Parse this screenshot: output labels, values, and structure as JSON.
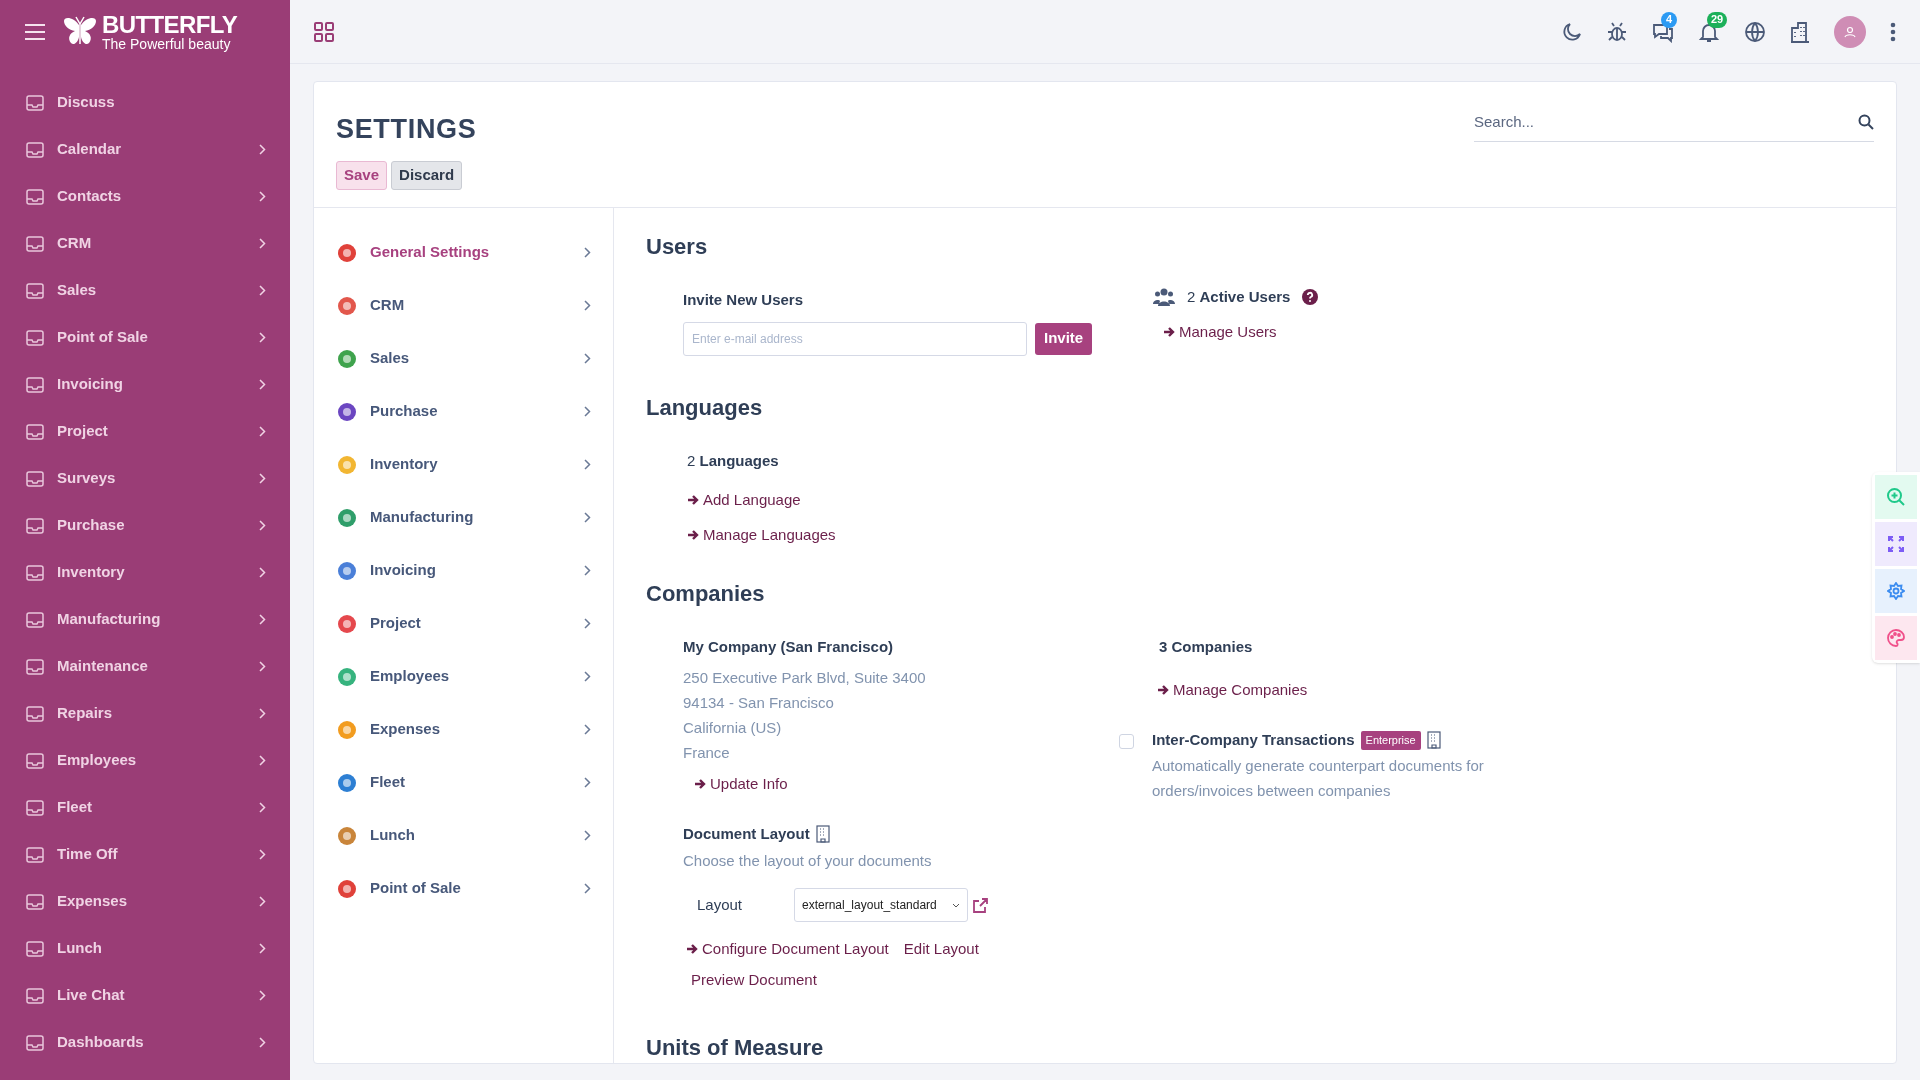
{
  "sidebar": {
    "brand": "BUTTERFLY",
    "tagline": "The Powerful beauty",
    "items": [
      {
        "label": "Discuss",
        "expandable": false
      },
      {
        "label": "Calendar",
        "expandable": true
      },
      {
        "label": "Contacts",
        "expandable": true
      },
      {
        "label": "CRM",
        "expandable": true
      },
      {
        "label": "Sales",
        "expandable": true
      },
      {
        "label": "Point of Sale",
        "expandable": true
      },
      {
        "label": "Invoicing",
        "expandable": true
      },
      {
        "label": "Project",
        "expandable": true
      },
      {
        "label": "Surveys",
        "expandable": true
      },
      {
        "label": "Purchase",
        "expandable": true
      },
      {
        "label": "Inventory",
        "expandable": true
      },
      {
        "label": "Manufacturing",
        "expandable": true
      },
      {
        "label": "Maintenance",
        "expandable": true
      },
      {
        "label": "Repairs",
        "expandable": true
      },
      {
        "label": "Employees",
        "expandable": true
      },
      {
        "label": "Fleet",
        "expandable": true
      },
      {
        "label": "Time Off",
        "expandable": true
      },
      {
        "label": "Expenses",
        "expandable": true
      },
      {
        "label": "Lunch",
        "expandable": true
      },
      {
        "label": "Live Chat",
        "expandable": true
      },
      {
        "label": "Dashboards",
        "expandable": true
      }
    ]
  },
  "topbar": {
    "message_count": "4",
    "notification_count": "29"
  },
  "page": {
    "title": "SETTINGS",
    "buttons": [
      {
        "label": "Save",
        "kind": "primary"
      },
      {
        "label": "Discard",
        "kind": "secondary"
      }
    ],
    "search": {
      "placeholder": "Search..."
    }
  },
  "settings_menu": [
    {
      "label": "General Settings",
      "selected": true,
      "color": "#e0413a"
    },
    {
      "label": "CRM",
      "selected": false,
      "color": "#e2574c"
    },
    {
      "label": "Sales",
      "selected": false,
      "color": "#3fa34d"
    },
    {
      "label": "Purchase",
      "selected": false,
      "color": "#6b46c1"
    },
    {
      "label": "Inventory",
      "selected": false,
      "color": "#f2b632"
    },
    {
      "label": "Manufacturing",
      "selected": false,
      "color": "#2f9e6a"
    },
    {
      "label": "Invoicing",
      "selected": false,
      "color": "#4a7fd8"
    },
    {
      "label": "Project",
      "selected": false,
      "color": "#e5484d"
    },
    {
      "label": "Employees",
      "selected": false,
      "color": "#36b37e"
    },
    {
      "label": "Expenses",
      "selected": false,
      "color": "#f29c1f"
    },
    {
      "label": "Fleet",
      "selected": false,
      "color": "#2d7fd3"
    },
    {
      "label": "Lunch",
      "selected": false,
      "color": "#c9853a"
    },
    {
      "label": "Point of Sale",
      "selected": false,
      "color": "#e0413a"
    }
  ],
  "users": {
    "title": "Users",
    "invite_label": "Invite New Users",
    "placeholder": "Enter e-mail address",
    "invite_button": "Invite",
    "active_users": "2 **Active Users**",
    "link": "Manage Users"
  },
  "languages": {
    "title": "Languages",
    "count": "2 **Languages**",
    "links": [
      "Add Language",
      "Manage Languages"
    ]
  },
  "companies": {
    "title": "Companies",
    "company_name": "My Company (San Francisco)",
    "address_lines": [
      "250 Executive Park Blvd, Suite 3400",
      "94134 - San Francisco",
      "California (US)",
      "France"
    ],
    "update_link": "Update Info",
    "count": "3 Companies",
    "manage_link": "Manage Companies",
    "inter_company": {
      "label": "Inter-Company Transactions",
      "badge": "Enterprise",
      "checked": false,
      "description": "Automatically generate counterpart documents for orders/invoices between companies"
    },
    "document_layout": {
      "label": "Document Layout",
      "description": "Choose the layout of your documents",
      "field_label": "Layout",
      "value": "external_layout_standard",
      "links": [
        {
          "label": "Configure Document Layout",
          "arrow": true
        },
        {
          "label": "Edit Layout",
          "arrow": false
        },
        {
          "label": "Preview Document",
          "arrow": false
        }
      ]
    }
  },
  "units": {
    "title": "Units of Measure"
  }
}
